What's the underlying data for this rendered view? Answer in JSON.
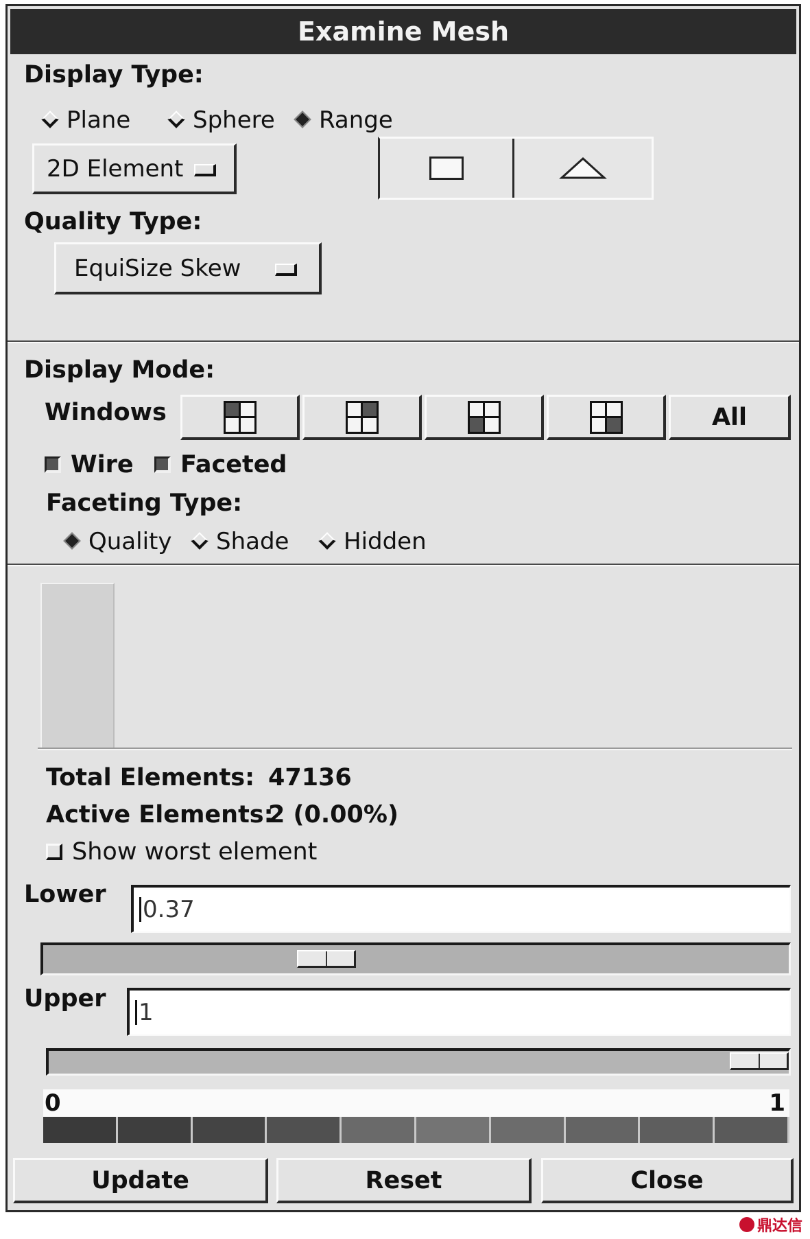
{
  "window": {
    "title": "Examine Mesh"
  },
  "display_type": {
    "label": "Display Type:",
    "options": [
      "Plane",
      "Sphere",
      "Range"
    ],
    "selected": "Range",
    "element_menu": "2D Element",
    "shape_buttons": [
      "rectangle-icon",
      "triangle-icon"
    ]
  },
  "quality_type": {
    "label": "Quality Type:",
    "menu": "EquiSize Skew"
  },
  "display_mode": {
    "label": "Display Mode:",
    "windows_label": "Windows",
    "window_buttons": [
      "window-top-left-icon",
      "window-top-right-icon",
      "window-bottom-left-icon",
      "window-bottom-right-icon"
    ],
    "all_label": "All",
    "wire": {
      "label": "Wire",
      "checked": true
    },
    "faceted": {
      "label": "Faceted",
      "checked": true
    },
    "faceting_type": {
      "label": "Faceting Type:",
      "options": [
        "Quality",
        "Shade",
        "Hidden"
      ],
      "selected": "Quality"
    }
  },
  "stats": {
    "total_label": "Total Elements:",
    "total_value": "47136",
    "active_label": "Active Elements:",
    "active_value": "2 (0.00%)",
    "show_worst": {
      "label": "Show worst element",
      "checked": false
    }
  },
  "range": {
    "lower_label": "Lower",
    "lower_value": "0.37",
    "upper_label": "Upper",
    "upper_value": "1",
    "lower_slider_fraction": 0.37,
    "upper_slider_fraction": 1.0,
    "scale_min": "0",
    "scale_max": "1",
    "colormap": [
      "#3a3a3a",
      "#3e3e3e",
      "#444444",
      "#505050",
      "#6a6a6a",
      "#747474",
      "#6c6c6c",
      "#646464",
      "#5e5e5e",
      "#5a5a5a"
    ]
  },
  "buttons": {
    "update": "Update",
    "reset": "Reset",
    "close": "Close"
  },
  "watermark": "鼎达信"
}
